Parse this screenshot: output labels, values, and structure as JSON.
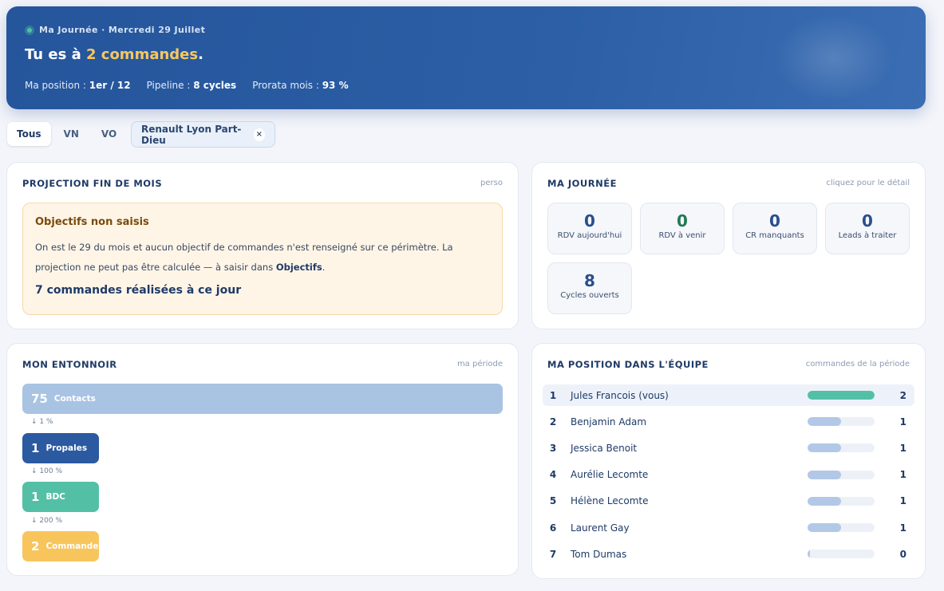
{
  "hero": {
    "subtitle": "Ma Journée · Mercredi 29 Juillet",
    "title_prefix": "Tu es à ",
    "title_highlight": "2 commandes",
    "title_suffix": ".",
    "stats": [
      {
        "label": "Ma position : ",
        "value": "1er / 12"
      },
      {
        "label": "Pipeline : ",
        "value": "8 cycles"
      },
      {
        "label": "Prorata mois : ",
        "value": "93 %"
      }
    ]
  },
  "filters": {
    "segments": [
      "Tous",
      "VN",
      "VO"
    ],
    "active_segment": "Tous",
    "site_chip": "Renault Lyon Part-Dieu",
    "chip_close": "×"
  },
  "projection": {
    "title": "PROJECTION FIN DE MOIS",
    "note": "perso",
    "alert_title": "Objectifs non saisis",
    "alert_text_before": "On est le 29 du mois et aucun objectif de commandes n'est renseigné sur ce périmètre. La projection ne peut pas être calculée — à saisir dans ",
    "alert_text_link": "Objectifs",
    "alert_text_after": ".",
    "done_text": "7 commandes réalisées à ce jour"
  },
  "journee": {
    "title": "MA JOURNÉE",
    "note": "cliquez pour le détail",
    "tiles": [
      {
        "value": "0",
        "label": "RDV aujourd'hui"
      },
      {
        "value": "0",
        "label": "RDV à venir"
      },
      {
        "value": "0",
        "label": "CR manquants"
      },
      {
        "value": "0",
        "label": "Leads à traiter"
      },
      {
        "value": "8",
        "label": "Cycles ouverts"
      }
    ]
  },
  "entonnoir": {
    "title": "MON ENTONNOIR",
    "note": "ma période",
    "stages": [
      {
        "value": "75",
        "label": "Contacts",
        "color": "#a9c3e3"
      },
      {
        "value": "1",
        "label": "Propales",
        "color": "#2b5aa1"
      },
      {
        "value": "1",
        "label": "BDC",
        "color": "#53c0a6"
      },
      {
        "value": "2",
        "label": "Commandes",
        "color": "#f8c55c"
      }
    ],
    "conversions": [
      "↓ 1 %",
      "↓ 100 %",
      "↓ 200 %"
    ]
  },
  "equipe": {
    "title": "MA POSITION DANS L'ÉQUIPE",
    "note": "commandes de la période",
    "max": 2,
    "rows": [
      {
        "rank": "1",
        "name": "Jules Francois (vous)",
        "value": 2,
        "me": true
      },
      {
        "rank": "2",
        "name": "Benjamin Adam",
        "value": 1,
        "me": false
      },
      {
        "rank": "3",
        "name": "Jessica Benoit",
        "value": 1,
        "me": false
      },
      {
        "rank": "4",
        "name": "Aurélie Lecomte",
        "value": 1,
        "me": false
      },
      {
        "rank": "5",
        "name": "Hélène Lecomte",
        "value": 1,
        "me": false
      },
      {
        "rank": "6",
        "name": "Laurent Gay",
        "value": 1,
        "me": false
      },
      {
        "rank": "7",
        "name": "Tom Dumas",
        "value": 0,
        "me": false
      }
    ]
  }
}
